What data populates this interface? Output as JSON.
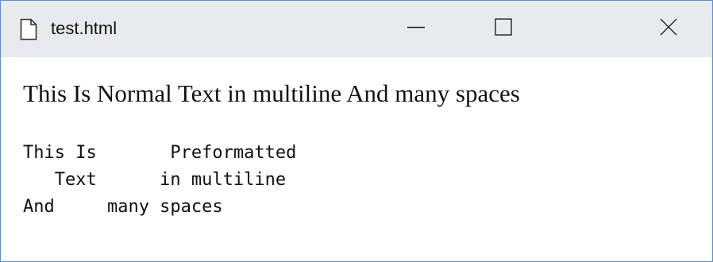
{
  "window": {
    "title": "test.html",
    "icon": "document-icon",
    "controls": [
      "minimize-icon",
      "maximize-icon",
      "close-icon"
    ]
  },
  "content": {
    "normal_text": "This Is Normal Text in multiline And many spaces",
    "preformatted_text": "This Is       Preformatted\n   Text      in multiline\nAnd     many spaces"
  },
  "colors": {
    "titlebar_bg": "#e9eaec",
    "window_border": "#5b8fd6",
    "text": "#111111"
  }
}
